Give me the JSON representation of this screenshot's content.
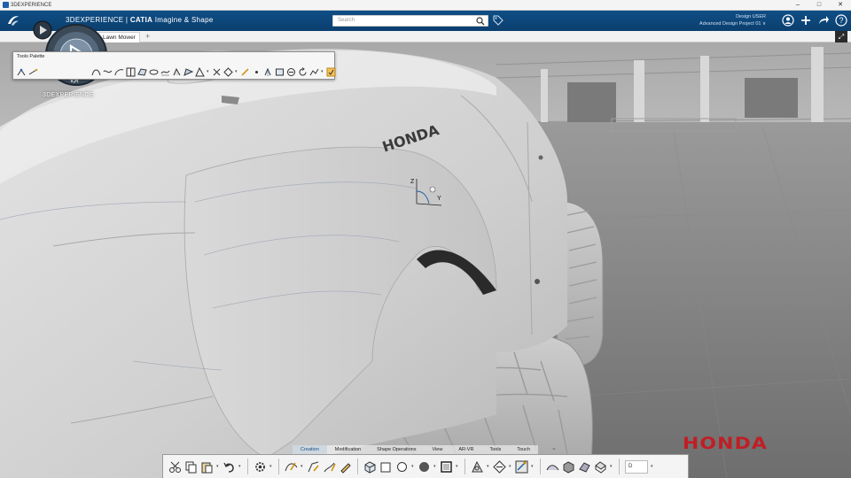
{
  "window": {
    "title": "3DEXPERIENCE",
    "controls": [
      "–",
      "□",
      "✕"
    ]
  },
  "appbar": {
    "brand_prefix": "3DEXPERIENCE | ",
    "brand_app": "CATIA",
    "brand_role": " Imagine & Shape",
    "search_placeholder": "Search",
    "user_name": "Design USER",
    "project": "Advanced Design Project 01 ∨"
  },
  "tabs": [
    {
      "label": "Lawn Mower"
    }
  ],
  "tab_add": "+",
  "compass": {
    "label": "3DEXPERIENCE",
    "left": "3D",
    "right": "i",
    "bottom": "V,R"
  },
  "palette": {
    "title": "Tools Palette"
  },
  "axes": {
    "z": "Z",
    "y": "Y"
  },
  "action_bar": {
    "tabs": [
      "Creation",
      "Modification",
      "Shape Operations",
      "View",
      "AR-VR",
      "Tools",
      "Touch"
    ],
    "active_tab": "Creation",
    "select_value": "D"
  },
  "watermark": "HONDA",
  "colors": {
    "appbar": "#0f4e86",
    "accent": "#0f4e86",
    "watermark": "#c8161d"
  }
}
